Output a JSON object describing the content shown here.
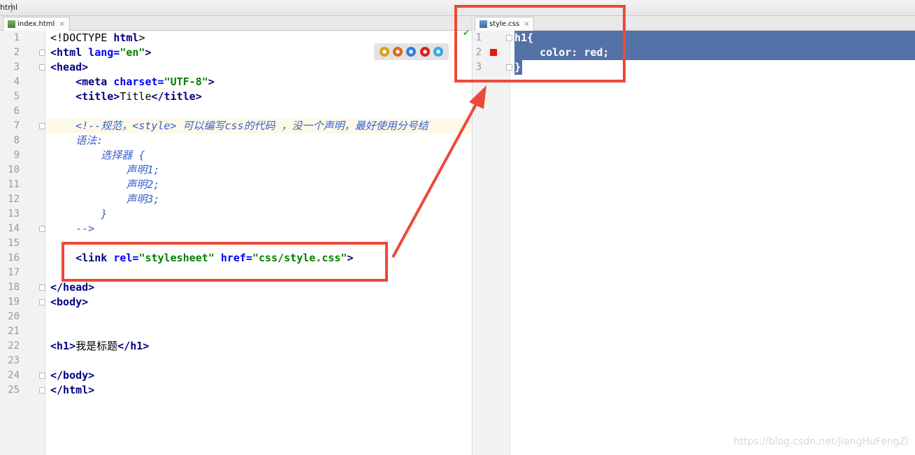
{
  "breadcrumb": {
    "label": "html"
  },
  "left_editor": {
    "tab": {
      "label": "index.html",
      "close": "×"
    },
    "current_line": 7,
    "lines": [
      {
        "n": "1",
        "segments": [
          {
            "c": "tok-doc",
            "t": "<!DOCTYPE "
          },
          {
            "c": "tok-kw",
            "t": "html"
          },
          {
            "c": "tok-doc",
            "t": ">"
          }
        ]
      },
      {
        "n": "2",
        "segments": [
          {
            "c": "tok-tag",
            "t": "<html "
          },
          {
            "c": "tok-attr",
            "t": "lang="
          },
          {
            "c": "tok-str",
            "t": "\"en\""
          },
          {
            "c": "tok-tag",
            "t": ">"
          }
        ]
      },
      {
        "n": "3",
        "segments": [
          {
            "c": "tok-tag",
            "t": "<head>"
          }
        ]
      },
      {
        "n": "4",
        "segments": [
          {
            "c": "tok-txt",
            "t": "    "
          },
          {
            "c": "tok-tag",
            "t": "<meta "
          },
          {
            "c": "tok-attr",
            "t": "charset="
          },
          {
            "c": "tok-str",
            "t": "\"UTF-8\""
          },
          {
            "c": "tok-tag",
            "t": ">"
          }
        ]
      },
      {
        "n": "5",
        "segments": [
          {
            "c": "tok-txt",
            "t": "    "
          },
          {
            "c": "tok-tag",
            "t": "<title>"
          },
          {
            "c": "tok-txt",
            "t": "Title"
          },
          {
            "c": "tok-tag",
            "t": "</title>"
          }
        ]
      },
      {
        "n": "6",
        "segments": []
      },
      {
        "n": "7",
        "segments": [
          {
            "c": "tok-cmt",
            "t": "    <!--规范，<style> 可以编写css的代码 ，没一个声明，最好使用分号结"
          }
        ]
      },
      {
        "n": "8",
        "segments": [
          {
            "c": "tok-cmt",
            "t": "    语法:"
          }
        ]
      },
      {
        "n": "9",
        "segments": [
          {
            "c": "tok-cmt",
            "t": "        选择器 {"
          }
        ]
      },
      {
        "n": "10",
        "segments": [
          {
            "c": "tok-cmt",
            "t": "            声明1;"
          }
        ]
      },
      {
        "n": "11",
        "segments": [
          {
            "c": "tok-cmt",
            "t": "            声明2;"
          }
        ]
      },
      {
        "n": "12",
        "segments": [
          {
            "c": "tok-cmt",
            "t": "            声明3;"
          }
        ]
      },
      {
        "n": "13",
        "segments": [
          {
            "c": "tok-cmt",
            "t": "        }"
          }
        ]
      },
      {
        "n": "14",
        "segments": [
          {
            "c": "tok-cmt",
            "t": "    -->"
          }
        ]
      },
      {
        "n": "15",
        "segments": []
      },
      {
        "n": "16",
        "segments": [
          {
            "c": "tok-txt",
            "t": "    "
          },
          {
            "c": "tok-tag",
            "t": "<link "
          },
          {
            "c": "tok-attr",
            "t": "rel="
          },
          {
            "c": "tok-str",
            "t": "\"stylesheet\""
          },
          {
            "c": "tok-txt",
            "t": " "
          },
          {
            "c": "tok-attr",
            "t": "href="
          },
          {
            "c": "tok-str",
            "t": "\"css/style.css\""
          },
          {
            "c": "tok-tag",
            "t": ">"
          }
        ]
      },
      {
        "n": "17",
        "segments": []
      },
      {
        "n": "18",
        "segments": [
          {
            "c": "tok-tag",
            "t": "</head>"
          }
        ]
      },
      {
        "n": "19",
        "segments": [
          {
            "c": "tok-tag",
            "t": "<body>"
          }
        ]
      },
      {
        "n": "20",
        "segments": []
      },
      {
        "n": "21",
        "segments": []
      },
      {
        "n": "22",
        "segments": [
          {
            "c": "tok-tag",
            "t": "<h1>"
          },
          {
            "c": "tok-txt",
            "t": "我是标题"
          },
          {
            "c": "tok-tag",
            "t": "</h1>"
          }
        ]
      },
      {
        "n": "23",
        "segments": []
      },
      {
        "n": "24",
        "segments": [
          {
            "c": "tok-tag",
            "t": "</body>"
          }
        ]
      },
      {
        "n": "25",
        "segments": [
          {
            "c": "tok-tag",
            "t": "</html>"
          }
        ]
      }
    ]
  },
  "browser_icons": [
    {
      "name": "chrome-icon",
      "color": "#d9a21b"
    },
    {
      "name": "firefox-icon",
      "color": "#e2661f"
    },
    {
      "name": "safari-icon",
      "color": "#2f7ee0"
    },
    {
      "name": "opera-icon",
      "color": "#d8221b"
    },
    {
      "name": "ie-icon",
      "color": "#39a8e0"
    }
  ],
  "right_editor": {
    "tab": {
      "label": "style.css",
      "close": "×"
    },
    "line_numbers": [
      "1",
      "2",
      "3"
    ],
    "lines": [
      "h1{",
      "    color: red;",
      "}"
    ]
  },
  "colors": {
    "annotation": "#ec4a38",
    "selection": "#5472a8",
    "breakpoint": "#e3170e"
  },
  "watermark": "https://blog.csdn.net/JiangHuFengZi"
}
